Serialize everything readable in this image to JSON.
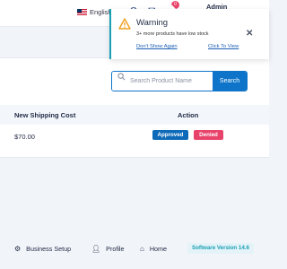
{
  "topbar": {
    "language": "English",
    "admin_name": "Admin",
    "cart_badge": "0"
  },
  "notification": {
    "title": "Warning",
    "message": "3+ more products have low stock",
    "dont_show": "Don't Show Again",
    "view": "Click To View"
  },
  "search": {
    "placeholder": "Search Product Name",
    "button": "Search"
  },
  "table": {
    "headers": [
      "New Shipping Cost",
      "Action"
    ],
    "rows": [
      {
        "cost": "$70.00",
        "approved": "Approved",
        "denied": "Denied"
      }
    ]
  },
  "footer": {
    "business_setup": "Business Setup",
    "profile": "Profile",
    "home": "Home",
    "version": "Software Version 14.6"
  },
  "colors": {
    "primary": "#0d74c9",
    "approved": "#0d6ab8",
    "denied": "#e8436a",
    "accent": "#1aa0b5"
  }
}
